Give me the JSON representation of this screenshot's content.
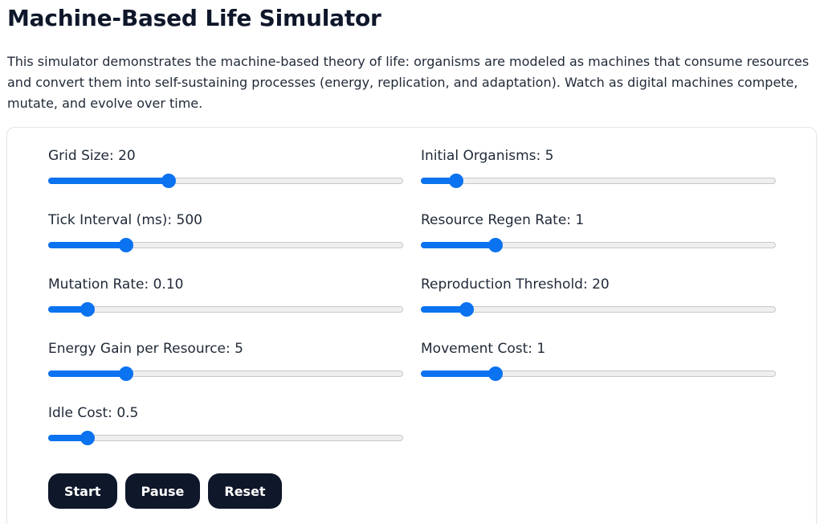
{
  "title": "Machine-Based Life Simulator",
  "intro": "This simulator demonstrates the machine-based theory of life: organisms are modeled as machines that consume resources and convert them into self-sustaining processes (energy, replication, and adaptation). Watch as digital machines compete, mutate, and evolve over time.",
  "controls": [
    {
      "label": "Grid Size: 20",
      "fraction": 0.34
    },
    {
      "label": "Initial Organisms: 5",
      "fraction": 0.1
    },
    {
      "label": "Tick Interval (ms): 500",
      "fraction": 0.22
    },
    {
      "label": "Resource Regen Rate: 1",
      "fraction": 0.21
    },
    {
      "label": "Mutation Rate: 0.10",
      "fraction": 0.11
    },
    {
      "label": "Reproduction Threshold: 20",
      "fraction": 0.13
    },
    {
      "label": "Energy Gain per Resource: 5",
      "fraction": 0.22
    },
    {
      "label": "Movement Cost: 1",
      "fraction": 0.21
    },
    {
      "label": "Idle Cost: 0.5",
      "fraction": 0.11
    }
  ],
  "buttons": {
    "start": "Start",
    "pause": "Pause",
    "reset": "Reset"
  },
  "colors": {
    "accent": "#0b72f0",
    "button_bg": "#0f172a"
  }
}
